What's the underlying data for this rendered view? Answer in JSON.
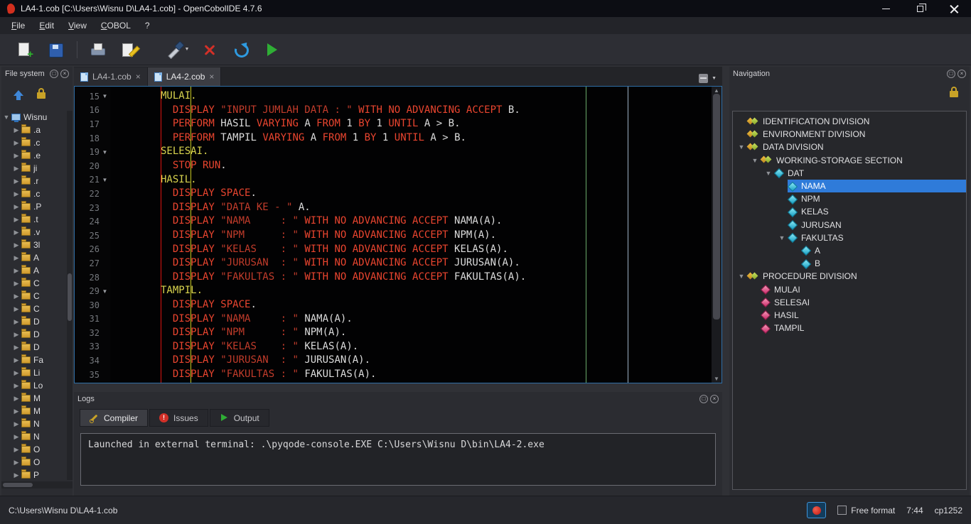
{
  "window": {
    "title": "LA4-1.cob [C:\\Users\\Wisnu D\\LA4-1.cob] - OpenCobolIDE 4.7.6"
  },
  "menu": {
    "items": [
      "File",
      "Edit",
      "View",
      "COBOL",
      "?"
    ]
  },
  "toolbar": {
    "buttons": [
      "new-file",
      "open-file",
      "print",
      "save-as",
      "compile",
      "cancel",
      "rebuild",
      "run"
    ]
  },
  "filesystem": {
    "title": "File system",
    "root": "Wisnu",
    "items": [
      ".a",
      ".c",
      ".e",
      "ji",
      ".r",
      ".c",
      ".P",
      ".t",
      ".v",
      "3l",
      "A",
      "A",
      "C",
      "C",
      "C",
      "D",
      "D",
      "D",
      "Fa",
      "Li",
      "Lo",
      "M",
      "M",
      "N",
      "N",
      "O",
      "O",
      "P"
    ]
  },
  "editor": {
    "tabs": [
      {
        "label": "LA4-1.cob",
        "active": false
      },
      {
        "label": "LA4-2.cob",
        "active": true
      }
    ],
    "lines": [
      {
        "n": 15,
        "fold": true,
        "tokens": [
          [
            "       MULAI.",
            "y"
          ]
        ]
      },
      {
        "n": 16,
        "fold": false,
        "tokens": [
          [
            "         ",
            "p"
          ],
          [
            "DISPLAY ",
            "k"
          ],
          [
            "\"INPUT JUMLAH DATA : \" ",
            "s"
          ],
          [
            "WITH NO ADVANCING ACCEPT ",
            "k"
          ],
          [
            "B.",
            "p"
          ]
        ]
      },
      {
        "n": 17,
        "fold": false,
        "tokens": [
          [
            "         ",
            "p"
          ],
          [
            "PERFORM ",
            "k"
          ],
          [
            "HASIL ",
            "p"
          ],
          [
            "VARYING ",
            "k"
          ],
          [
            "A ",
            "p"
          ],
          [
            "FROM ",
            "k"
          ],
          [
            "1 ",
            "p"
          ],
          [
            "BY ",
            "k"
          ],
          [
            "1 ",
            "p"
          ],
          [
            "UNTIL ",
            "k"
          ],
          [
            "A > B.",
            "p"
          ]
        ]
      },
      {
        "n": 18,
        "fold": false,
        "tokens": [
          [
            "         ",
            "p"
          ],
          [
            "PERFORM ",
            "k"
          ],
          [
            "TAMPIL ",
            "p"
          ],
          [
            "VARYING ",
            "k"
          ],
          [
            "A ",
            "p"
          ],
          [
            "FROM ",
            "k"
          ],
          [
            "1 ",
            "p"
          ],
          [
            "BY ",
            "k"
          ],
          [
            "1 ",
            "p"
          ],
          [
            "UNTIL ",
            "k"
          ],
          [
            "A > B.",
            "p"
          ]
        ]
      },
      {
        "n": 19,
        "fold": true,
        "tokens": [
          [
            "       SELESAI.",
            "y"
          ]
        ]
      },
      {
        "n": 20,
        "fold": false,
        "tokens": [
          [
            "         ",
            "p"
          ],
          [
            "STOP RUN",
            "k"
          ],
          [
            ".",
            "p"
          ]
        ]
      },
      {
        "n": 21,
        "fold": true,
        "tokens": [
          [
            "       HASIL.",
            "y"
          ]
        ]
      },
      {
        "n": 22,
        "fold": false,
        "tokens": [
          [
            "         ",
            "p"
          ],
          [
            "DISPLAY SPACE",
            "k"
          ],
          [
            ".",
            "p"
          ]
        ]
      },
      {
        "n": 23,
        "fold": false,
        "tokens": [
          [
            "         ",
            "p"
          ],
          [
            "DISPLAY ",
            "k"
          ],
          [
            "\"DATA KE - \" ",
            "s"
          ],
          [
            "A.",
            "p"
          ]
        ]
      },
      {
        "n": 24,
        "fold": false,
        "tokens": [
          [
            "         ",
            "p"
          ],
          [
            "DISPLAY ",
            "k"
          ],
          [
            "\"NAMA     : \" ",
            "s"
          ],
          [
            "WITH NO ADVANCING ACCEPT ",
            "k"
          ],
          [
            "NAMA(A).",
            "p"
          ]
        ]
      },
      {
        "n": 25,
        "fold": false,
        "tokens": [
          [
            "         ",
            "p"
          ],
          [
            "DISPLAY ",
            "k"
          ],
          [
            "\"NPM      : \" ",
            "s"
          ],
          [
            "WITH NO ADVANCING ACCEPT ",
            "k"
          ],
          [
            "NPM(A).",
            "p"
          ]
        ]
      },
      {
        "n": 26,
        "fold": false,
        "tokens": [
          [
            "         ",
            "p"
          ],
          [
            "DISPLAY ",
            "k"
          ],
          [
            "\"KELAS    : \" ",
            "s"
          ],
          [
            "WITH NO ADVANCING ACCEPT ",
            "k"
          ],
          [
            "KELAS(A).",
            "p"
          ]
        ]
      },
      {
        "n": 27,
        "fold": false,
        "tokens": [
          [
            "         ",
            "p"
          ],
          [
            "DISPLAY ",
            "k"
          ],
          [
            "\"JURUSAN  : \" ",
            "s"
          ],
          [
            "WITH NO ADVANCING ACCEPT ",
            "k"
          ],
          [
            "JURUSAN(A).",
            "p"
          ]
        ]
      },
      {
        "n": 28,
        "fold": false,
        "tokens": [
          [
            "         ",
            "p"
          ],
          [
            "DISPLAY ",
            "k"
          ],
          [
            "\"FAKULTAS : \" ",
            "s"
          ],
          [
            "WITH NO ADVANCING ACCEPT ",
            "k"
          ],
          [
            "FAKULTAS(A).",
            "p"
          ]
        ]
      },
      {
        "n": 29,
        "fold": true,
        "tokens": [
          [
            "       TAMPIL.",
            "y"
          ]
        ]
      },
      {
        "n": 30,
        "fold": false,
        "tokens": [
          [
            "         ",
            "p"
          ],
          [
            "DISPLAY SPACE",
            "k"
          ],
          [
            ".",
            "p"
          ]
        ]
      },
      {
        "n": 31,
        "fold": false,
        "tokens": [
          [
            "         ",
            "p"
          ],
          [
            "DISPLAY ",
            "k"
          ],
          [
            "\"NAMA     : \" ",
            "s"
          ],
          [
            "NAMA(A).",
            "p"
          ]
        ]
      },
      {
        "n": 32,
        "fold": false,
        "tokens": [
          [
            "         ",
            "p"
          ],
          [
            "DISPLAY ",
            "k"
          ],
          [
            "\"NPM      : \" ",
            "s"
          ],
          [
            "NPM(A).",
            "p"
          ]
        ]
      },
      {
        "n": 33,
        "fold": false,
        "tokens": [
          [
            "         ",
            "p"
          ],
          [
            "DISPLAY ",
            "k"
          ],
          [
            "\"KELAS    : \" ",
            "s"
          ],
          [
            "KELAS(A).",
            "p"
          ]
        ]
      },
      {
        "n": 34,
        "fold": false,
        "tokens": [
          [
            "         ",
            "p"
          ],
          [
            "DISPLAY ",
            "k"
          ],
          [
            "\"JURUSAN  : \" ",
            "s"
          ],
          [
            "JURUSAN(A).",
            "p"
          ]
        ]
      },
      {
        "n": 35,
        "fold": false,
        "tokens": [
          [
            "         ",
            "p"
          ],
          [
            "DISPLAY ",
            "k"
          ],
          [
            "\"FAKULTAS : \" ",
            "s"
          ],
          [
            "FAKULTAS(A).",
            "p"
          ]
        ]
      }
    ]
  },
  "navigation": {
    "title": "Navigation",
    "items": [
      {
        "label": "IDENTIFICATION DIVISION",
        "depth": 0,
        "icon": "division"
      },
      {
        "label": "ENVIRONMENT DIVISION",
        "depth": 0,
        "icon": "division"
      },
      {
        "label": "DATA DIVISION",
        "depth": 0,
        "icon": "division",
        "expanded": true
      },
      {
        "label": "WORKING-STORAGE SECTION",
        "depth": 1,
        "icon": "division",
        "expanded": true
      },
      {
        "label": "DAT",
        "depth": 2,
        "icon": "data",
        "expanded": true
      },
      {
        "label": "NAMA",
        "depth": 3,
        "icon": "data",
        "selected": true
      },
      {
        "label": "NPM",
        "depth": 3,
        "icon": "data"
      },
      {
        "label": "KELAS",
        "depth": 3,
        "icon": "data"
      },
      {
        "label": "JURUSAN",
        "depth": 3,
        "icon": "data"
      },
      {
        "label": "FAKULTAS",
        "depth": 3,
        "icon": "data",
        "expanded": true
      },
      {
        "label": "A",
        "depth": 4,
        "icon": "data"
      },
      {
        "label": "B",
        "depth": 4,
        "icon": "data"
      },
      {
        "label": "PROCEDURE DIVISION",
        "depth": 0,
        "icon": "division",
        "expanded": true
      },
      {
        "label": "MULAI",
        "depth": 1,
        "icon": "procedure"
      },
      {
        "label": "SELESAI",
        "depth": 1,
        "icon": "procedure"
      },
      {
        "label": "HASIL",
        "depth": 1,
        "icon": "procedure"
      },
      {
        "label": "TAMPIL",
        "depth": 1,
        "icon": "procedure"
      }
    ]
  },
  "logs": {
    "title": "Logs",
    "tabs": [
      {
        "label": "Compiler",
        "icon": "compiler",
        "active": true
      },
      {
        "label": "Issues",
        "icon": "issues",
        "active": false
      },
      {
        "label": "Output",
        "icon": "output",
        "active": false
      }
    ],
    "message": "Launched in external terminal: .\\pyqode-console.EXE C:\\Users\\Wisnu D\\bin\\LA4-2.exe"
  },
  "statusbar": {
    "path": "C:\\Users\\Wisnu D\\LA4-1.cob",
    "free_format_label": "Free format",
    "free_format_checked": false,
    "cursor_position": "7:44",
    "encoding": "cp1252"
  },
  "colors": {
    "selection": "#2f7bd9",
    "keyword": "#ea452f",
    "string": "#c23c2b",
    "paragraph": "#d9d44e",
    "run_green": "#2fae35",
    "cancel_red": "#d23028"
  }
}
